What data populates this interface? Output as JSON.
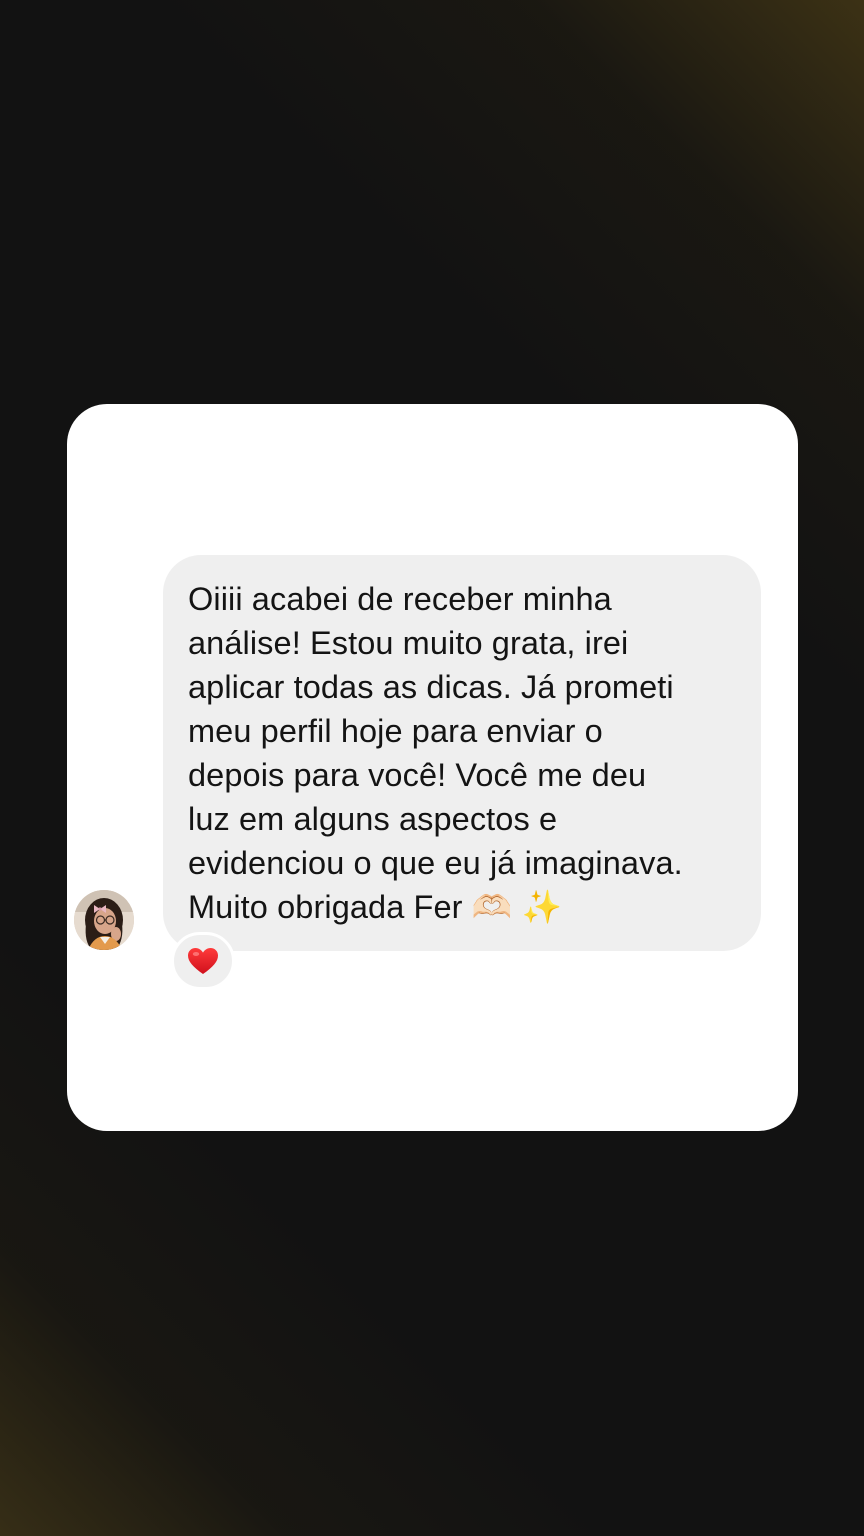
{
  "message": {
    "lines": [
      "Oiiii acabei de receber minha",
      "análise! Estou muito grata, irei",
      "aplicar todas as dicas. Já prometi",
      "meu perfil hoje para enviar o",
      "depois para você! Você me deu",
      "luz em alguns aspectos e",
      "evidenciou o que eu já imaginava.",
      "Muito obrigada Fer"
    ],
    "emojis": [
      "🫶🏻",
      "✨"
    ]
  },
  "reaction": {
    "emoji": "❤️",
    "icon": "heart-icon",
    "color": "#e0202a"
  },
  "sender": {
    "avatar_icon": "avatar"
  },
  "colors": {
    "background": "#121212",
    "card": "#ffffff",
    "bubble": "#efefef",
    "text": "#141414",
    "glow": "#4a3c16"
  }
}
